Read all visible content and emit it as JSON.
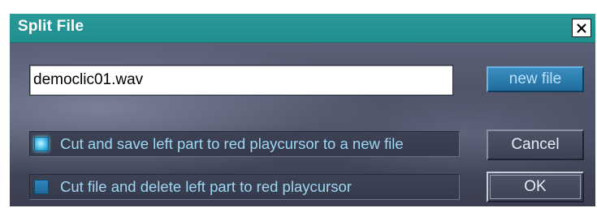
{
  "dialog": {
    "title": "Split File",
    "close_symbol": "close-icon"
  },
  "filename": {
    "value": "democlic01.wav"
  },
  "buttons": {
    "new_file": "new file",
    "cancel": "Cancel",
    "ok": "OK"
  },
  "options": [
    {
      "label": "Cut and save left part to red playcursor to a new file",
      "selected": true
    },
    {
      "label": "Cut file and delete left part to red playcursor",
      "selected": false
    }
  ],
  "colors": {
    "titlebar": "#2b9a9b",
    "option_text": "#9fd6f2",
    "new_file_button": "#1f6c9d"
  }
}
